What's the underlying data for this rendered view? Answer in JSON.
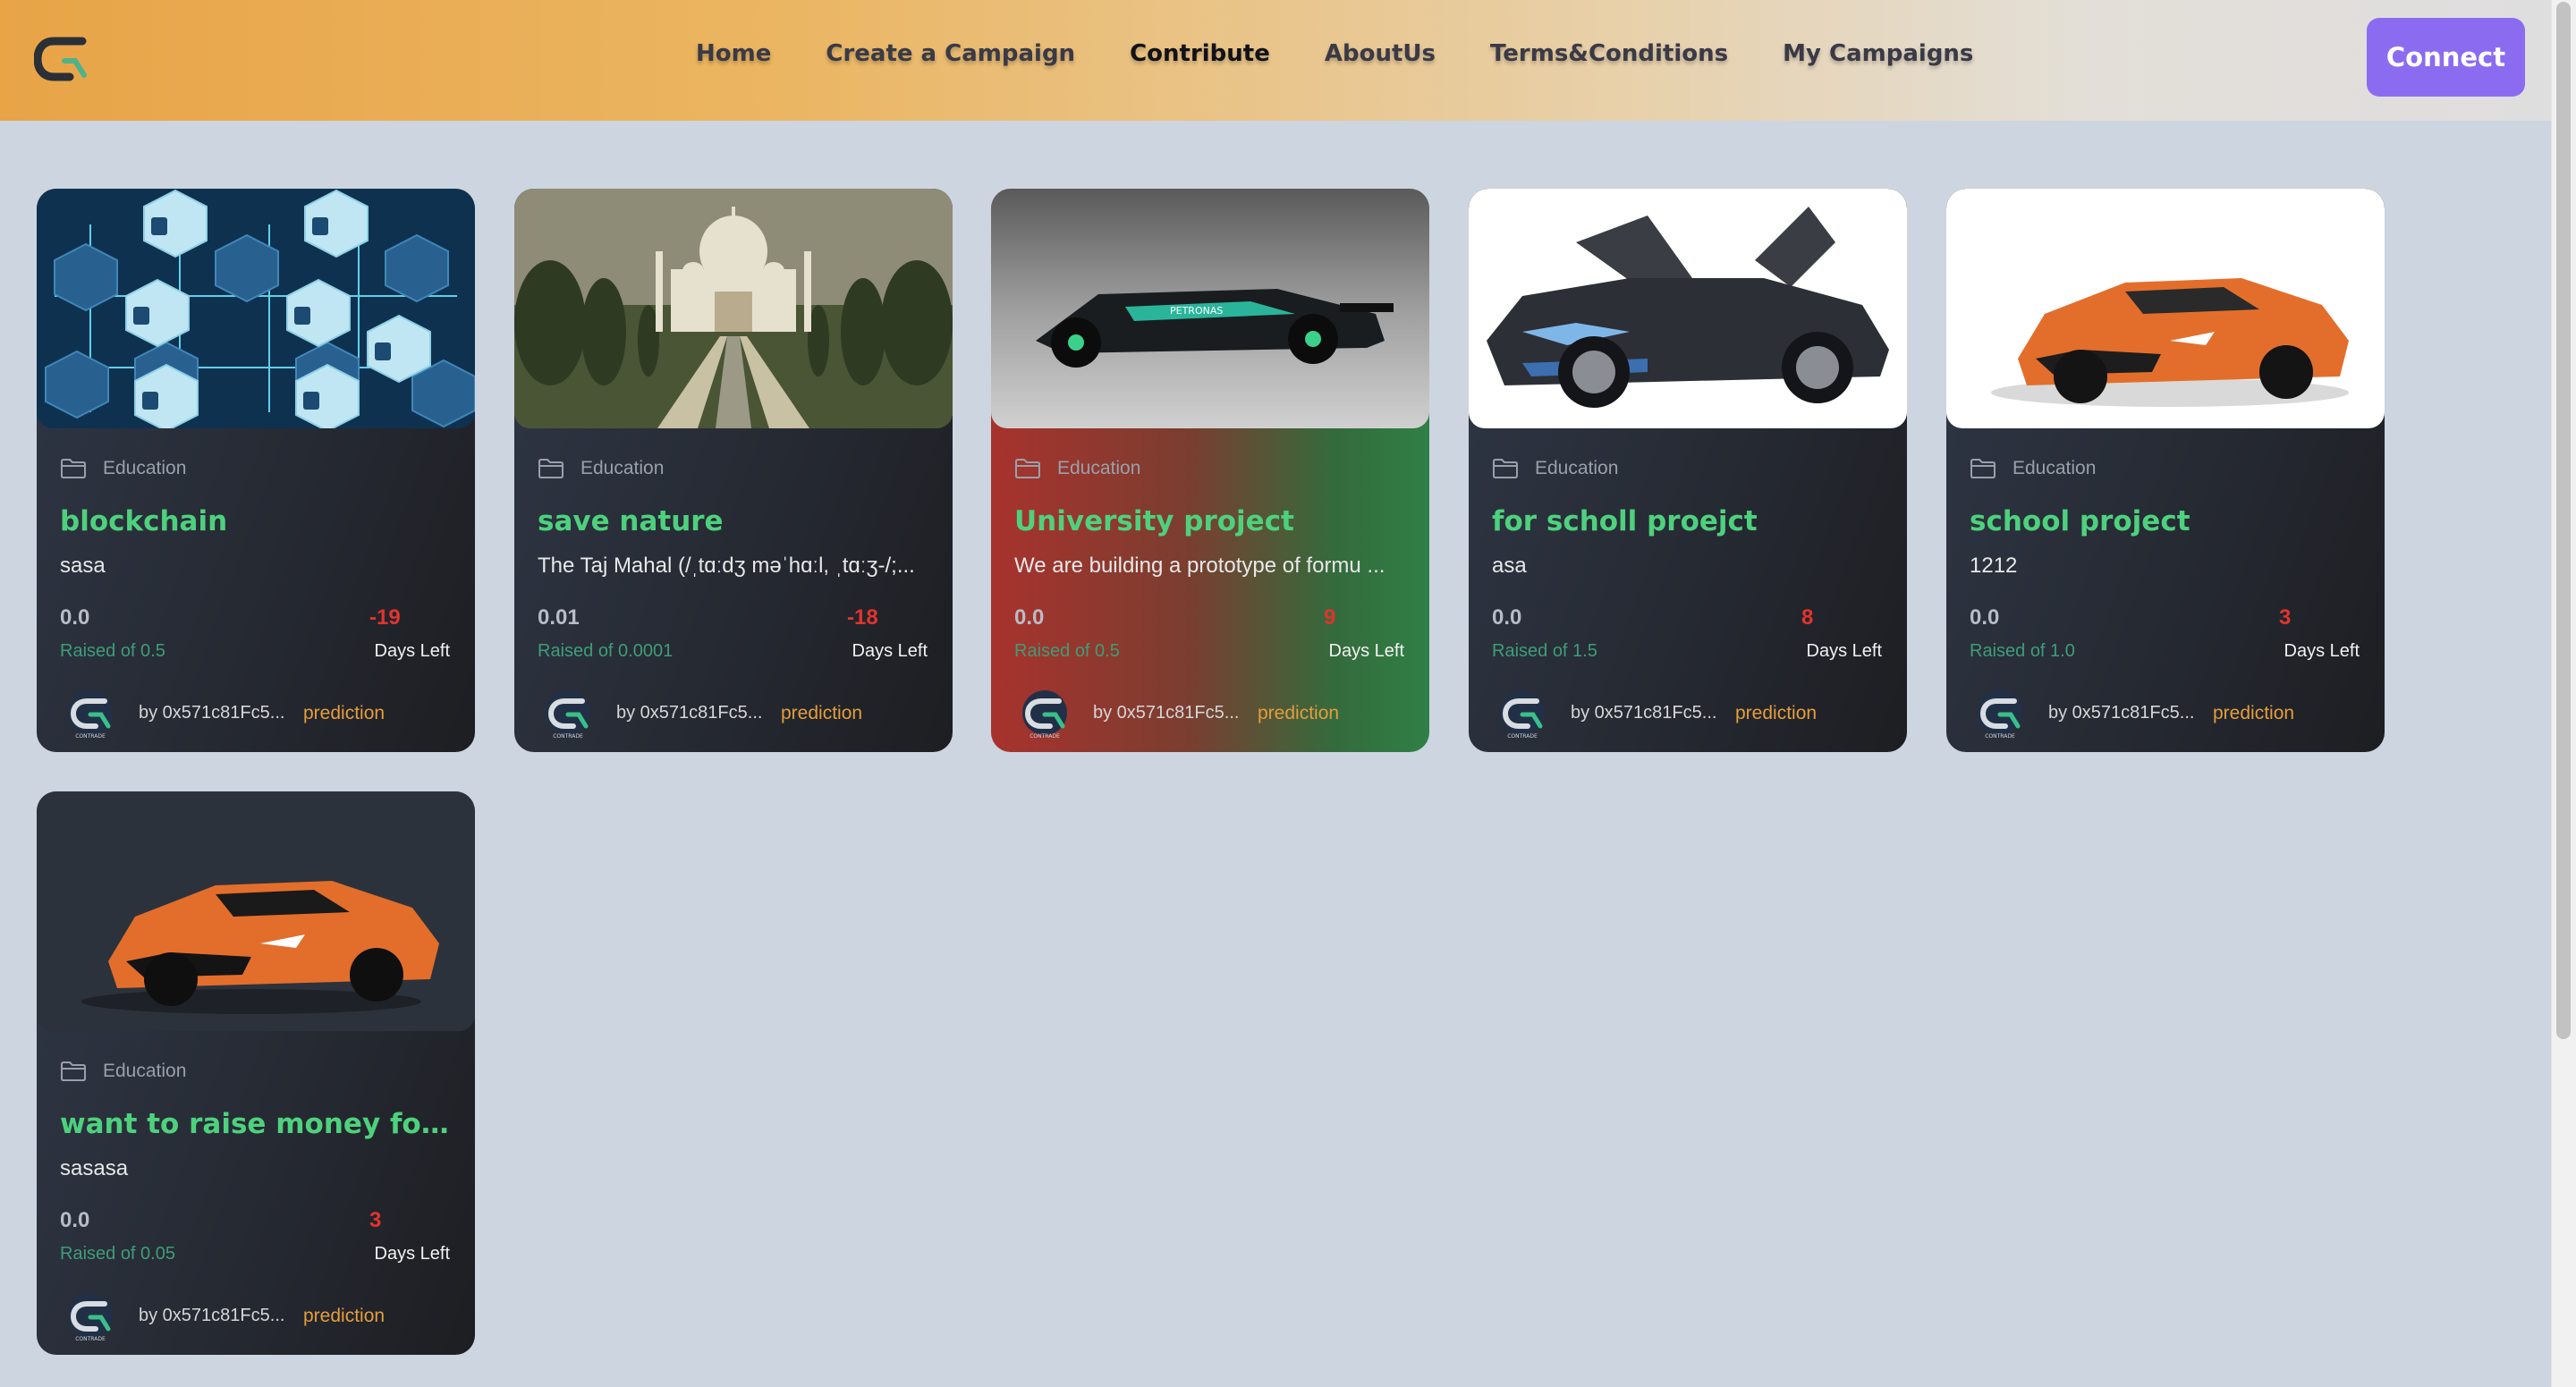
{
  "nav": {
    "links": [
      "Home",
      "Create a Campaign",
      "Contribute",
      "AboutUs",
      "Terms&Conditions",
      "My Campaigns"
    ],
    "active": "Contribute",
    "connect_label": "Connect"
  },
  "colors": {
    "accent_purple": "#8b6cf0",
    "title_green": "#4ed17d",
    "days_red": "#e0342f",
    "raised_green": "#3f9d78",
    "prediction_orange": "#e59d3c"
  },
  "campaigns": [
    {
      "image": "nft-cubes-image",
      "category": "Education",
      "title": "blockchain",
      "description": "sasa",
      "raised": "0.0",
      "raised_label": "Raised of 0.5",
      "days": "-19",
      "days_label": "Days Left",
      "owner": "by 0x571c81Fc5...",
      "link": "prediction"
    },
    {
      "image": "taj-mahal-image",
      "category": "Education",
      "title": "save nature",
      "description": "The Taj Mahal (/ˌtɑːdʒ məˈhɑːl, ˌtɑːʒ-/;...",
      "raised": "0.01",
      "raised_label": "Raised of 0.0001",
      "days": "-18",
      "days_label": "Days Left",
      "owner": "by 0x571c81Fc5...",
      "link": "prediction"
    },
    {
      "image": "f1-car-image",
      "category": "Education",
      "title": "University project",
      "description": "We are building a prototype of formu ...",
      "raised": "0.0",
      "raised_label": "Raised of 0.5",
      "days": "9",
      "days_label": "Days Left",
      "owner": "by 0x571c81Fc5...",
      "link": "prediction"
    },
    {
      "image": "bmw-i8-image",
      "category": "Education",
      "title": "for scholl proejct",
      "description": "asa",
      "raised": "0.0",
      "raised_label": "Raised of 1.5",
      "days": "8",
      "days_label": "Days Left",
      "owner": "by 0x571c81Fc5...",
      "link": "prediction"
    },
    {
      "image": "orange-supercar-image",
      "category": "Education",
      "title": "school project",
      "description": "1212",
      "raised": "0.0",
      "raised_label": "Raised of 1.0",
      "days": "3",
      "days_label": "Days Left",
      "owner": "by 0x571c81Fc5...",
      "link": "prediction"
    },
    {
      "image": "orange-supercar-dark-image",
      "category": "Education",
      "title": "want to raise money for liv...",
      "description": "sasasa",
      "raised": "0.0",
      "raised_label": "Raised of 0.05",
      "days": "3",
      "days_label": "Days Left",
      "owner": "by 0x571c81Fc5...",
      "link": "prediction"
    }
  ]
}
